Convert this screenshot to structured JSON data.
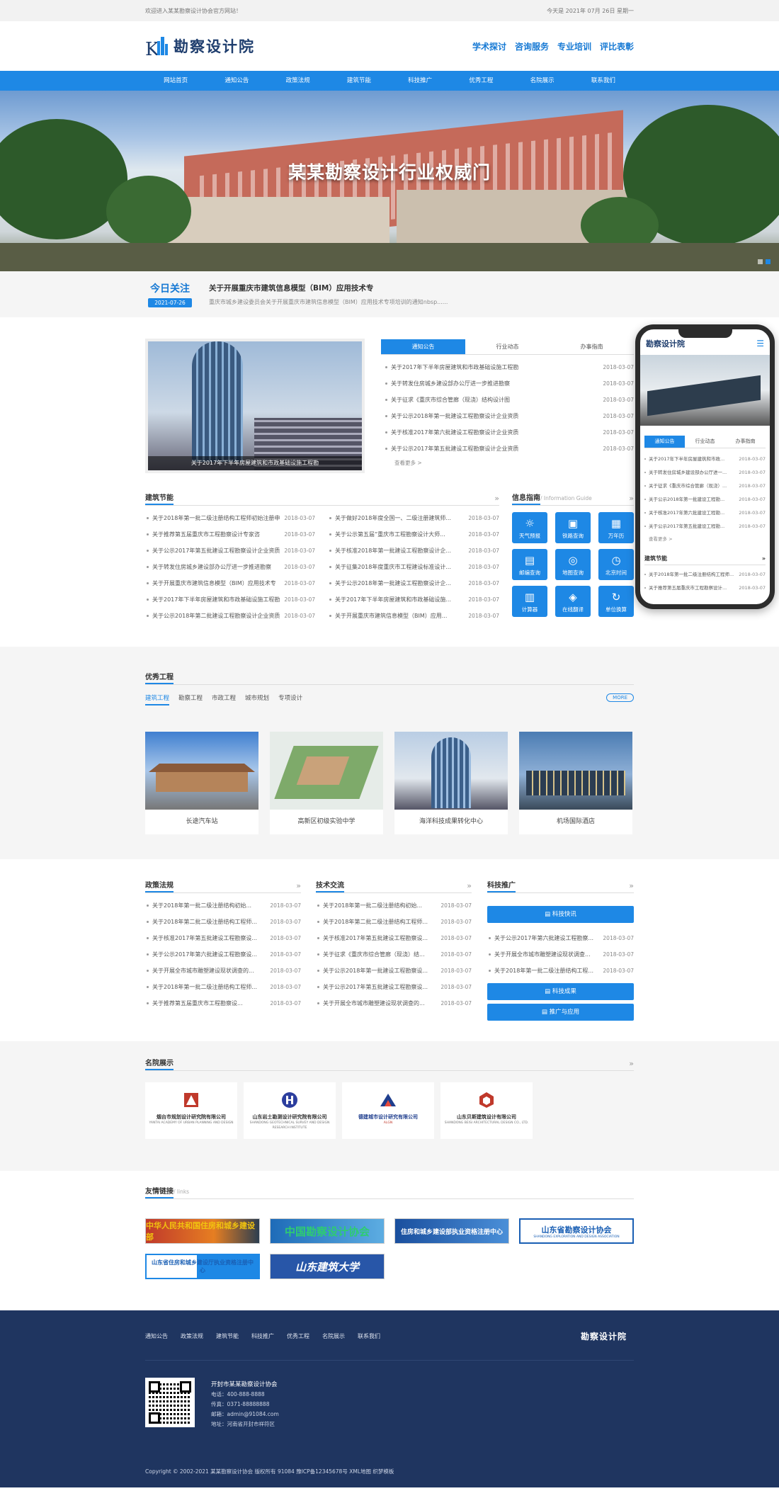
{
  "topbar": {
    "welcome": "欢迎进入某某勘察设计协会官方网站！",
    "date": "今天是 2021年 07月 26日 星期一"
  },
  "header": {
    "logo_text": "勘察设计院",
    "links": [
      "学术探讨",
      "咨询服务",
      "专业培训",
      "评比表彰"
    ]
  },
  "nav": [
    "网站首页",
    "通知公告",
    "政策法规",
    "建筑节能",
    "科技推广",
    "优秀工程",
    "名院展示",
    "联系我们"
  ],
  "banner": {
    "slogan": "某某勘察设计行业权威门"
  },
  "today": {
    "tag": "今日关注",
    "date": "2021-07-26",
    "title": "关于开展重庆市建筑信息模型（BIM）应用技术专",
    "desc": "重庆市城乡建设委员会关于开展重庆市建筑信息模型（BIM）应用技术专项培训的通知nbsp......"
  },
  "news": {
    "image_caption": "关于2017年下半年房屋建筑和市政基础设施工程勘",
    "tabs": [
      "通知公告",
      "行业动态",
      "办事指南"
    ],
    "items": [
      {
        "title": "关于2017年下半年房屋建筑和市政基础设施工程勘",
        "date": "2018-03-07"
      },
      {
        "title": "关于转发住房城乡建设部办公厅进一步推进勘察",
        "date": "2018-03-07"
      },
      {
        "title": "关于征求《重庆市综合管廊（现浇）结构设计图",
        "date": "2018-03-07"
      },
      {
        "title": "关于公示2018年第一批建设工程勘察设计企业资质",
        "date": "2018-03-07"
      },
      {
        "title": "关于核准2017年第六批建设工程勘察设计企业资质",
        "date": "2018-03-07"
      },
      {
        "title": "关于公示2017年第五批建设工程勘察设计企业资质",
        "date": "2018-03-07"
      }
    ],
    "more": "查看更多 >"
  },
  "energy": {
    "title": "建筑节能",
    "left": [
      {
        "title": "关于2018年第一批二级注册结构工程师初始注册申",
        "date": "2018-03-07"
      },
      {
        "title": "关于推荐第五届重庆市工程勘察设计专家咨",
        "date": "2018-03-07"
      },
      {
        "title": "关于公示2017年第五批建设工程勘察设计企业资质",
        "date": "2018-03-07"
      },
      {
        "title": "关于转发住房城乡建设部办公厅进一步推进勘察",
        "date": "2018-03-07"
      },
      {
        "title": "关于开展重庆市建筑信息模型（BIM）应用技术专",
        "date": "2018-03-07"
      },
      {
        "title": "关于2017年下半年房屋建筑和市政基础设施工程勘",
        "date": "2018-03-07"
      },
      {
        "title": "关于公示2018年第二批建设工程勘察设计企业资质",
        "date": "2018-03-07"
      }
    ],
    "right": [
      {
        "title": "关于做好2018年度全国一、二级注册建筑师...",
        "date": "2018-03-07"
      },
      {
        "title": "关于公示第五届“重庆市工程勘察设计大师...",
        "date": "2018-03-07"
      },
      {
        "title": "关于核准2018年第一批建设工程勘察设计企...",
        "date": "2018-03-07"
      },
      {
        "title": "关于征集2018年度重庆市工程建设标准设计...",
        "date": "2018-03-07"
      },
      {
        "title": "关于公示2018年第一批建设工程勘察设计企...",
        "date": "2018-03-07"
      },
      {
        "title": "关于2017年下半年房屋建筑和市政基础设施...",
        "date": "2018-03-07"
      },
      {
        "title": "关于开展重庆市建筑信息模型（BIM）应用...",
        "date": "2018-03-07"
      }
    ]
  },
  "guide": {
    "title": "信息指南",
    "subtitle": "/ Information Guide",
    "tools": [
      {
        "label": "天气预报",
        "icon": "☼"
      },
      {
        "label": "铁路查询",
        "icon": "▣"
      },
      {
        "label": "万年历",
        "icon": "▦"
      },
      {
        "label": "邮编查询",
        "icon": "▤"
      },
      {
        "label": "地图查询",
        "icon": "◎"
      },
      {
        "label": "北京时间",
        "icon": "◷"
      },
      {
        "label": "计算器",
        "icon": "▥"
      },
      {
        "label": "在线翻译",
        "icon": "◈"
      },
      {
        "label": "单位换算",
        "icon": "↻"
      }
    ]
  },
  "phone": {
    "logo": "勘察设计院",
    "tabs": [
      "通知公告",
      "行业动态",
      "办事指南"
    ],
    "items": [
      {
        "title": "关于2017年下半年房屋建筑和市政...",
        "date": "2018-03-07"
      },
      {
        "title": "关于转发住房城乡建设部办公厅进一...",
        "date": "2018-03-07"
      },
      {
        "title": "关于征求《重庆市综合管廊（现浇）...",
        "date": "2018-03-07"
      },
      {
        "title": "关于公示2018年第一批建设工程勘...",
        "date": "2018-03-07"
      },
      {
        "title": "关于核准2017年第六批建设工程勘...",
        "date": "2018-03-07"
      },
      {
        "title": "关于公示2017年第五批建设工程勘...",
        "date": "2018-03-07"
      }
    ],
    "more": "查看更多 >",
    "section": "建筑节能",
    "items2": [
      {
        "title": "关于2018年第一批二级注册结构工程师...",
        "date": "2018-03-07"
      },
      {
        "title": "关于推荐第五届重庆市工程勘察设计...",
        "date": "2018-03-07"
      }
    ]
  },
  "projects": {
    "title": "优秀工程",
    "tabs": [
      "建筑工程",
      "勘察工程",
      "市政工程",
      "城市规划",
      "专项设计"
    ],
    "more": "MORE",
    "items": [
      "长途汽车站",
      "高新区初级实验中学",
      "海洋科技成果转化中心",
      "机场国际酒店"
    ]
  },
  "policy": {
    "title": "政策法规",
    "items": [
      {
        "title": "关于2018年第一批二级注册结构初始...",
        "date": "2018-03-07"
      },
      {
        "title": "关于2018年第二批二级注册结构工程师...",
        "date": "2018-03-07"
      },
      {
        "title": "关于核准2017年第五批建设工程勘察设...",
        "date": "2018-03-07"
      },
      {
        "title": "关于公示2017年第六批建设工程勘察设...",
        "date": "2018-03-07"
      },
      {
        "title": "关于开展全市城市雕塑建设现状调查的...",
        "date": "2018-03-07"
      },
      {
        "title": "关于2018年第一批二级注册结构工程师...",
        "date": "2018-03-07"
      },
      {
        "title": "关于推荐第五届重庆市工程勘察设...",
        "date": "2018-03-07"
      }
    ]
  },
  "tech": {
    "title": "技术交流",
    "items": [
      {
        "title": "关于2018年第一批二级注册结构初始...",
        "date": "2018-03-07"
      },
      {
        "title": "关于2018年第二批二级注册结构工程师...",
        "date": "2018-03-07"
      },
      {
        "title": "关于核准2017年第五批建设工程勘察设...",
        "date": "2018-03-07"
      },
      {
        "title": "关于征求《重庆市综合管廊（现浇）结...",
        "date": "2018-03-07"
      },
      {
        "title": "关于公示2018年第一批建设工程勘察设...",
        "date": "2018-03-07"
      },
      {
        "title": "关于公示2017年第五批建设工程勘察设...",
        "date": "2018-03-07"
      },
      {
        "title": "关于开展全市城市雕塑建设现状调查的...",
        "date": "2018-03-07"
      }
    ]
  },
  "promo": {
    "title": "科技推广",
    "btn1": "科技快讯",
    "items": [
      {
        "title": "关于公示2017年第六批建设工程勘察...",
        "date": "2018-03-07"
      },
      {
        "title": "关于开展全市城市雕塑建设现状调查...",
        "date": "2018-03-07"
      },
      {
        "title": "关于2018年第一批二级注册结构工程...",
        "date": "2018-03-07"
      }
    ],
    "btn2": "科技成果",
    "btn3": "推广与应用"
  },
  "institutes": {
    "title": "名院展示",
    "items": [
      {
        "cn": "烟台市规划设计研究院有限公司",
        "en": "YANTAI ACADEMY OF URBAN PLANNING AND DESIGN"
      },
      {
        "cn": "山东岩土勘测设计研究院有限公司",
        "en": "SHANDONG GEOTECHNICAL SURVEY AND DESIGN RESEARCH INSTITUTE"
      },
      {
        "cn": "德建城市设计研究有限公司",
        "en": "ALGN"
      },
      {
        "cn": "山东贝斯建筑设计有限公司",
        "en": "SHANDONG BEISI ARCHITECTURAL DESIGN CO., LTD."
      }
    ]
  },
  "links": {
    "title": "友情链接",
    "subtitle": "/ links",
    "items": [
      "中华人民共和国住房和城乡建设部",
      "中国勘察设计协会",
      "住房和城乡建设部执业资格注册中心",
      "山东省勘察设计协会",
      "山东省住房和城乡建设厅执业资格注册中心",
      "山东建筑大学"
    ],
    "items_sub": [
      "",
      "",
      "",
      "SHANDONG EXPLORATION AND DESIGN ASSOCIATION",
      "",
      ""
    ]
  },
  "footer": {
    "nav": [
      "通知公告",
      "政策法规",
      "建筑节能",
      "科技推广",
      "优秀工程",
      "名院展示",
      "联系我们"
    ],
    "logo": "勘察设计院",
    "org": "开封市某某勘察设计协会",
    "phone": "电话：400-888-8888",
    "fax": "传真：0371-88888888",
    "email": "邮箱：admin@91084.com",
    "address": "地址：河南省开封市祥符区",
    "copyright": "Copyright © 2002-2021 某某勘察设计协会 版权所有 91084 豫ICP备12345678号 XML地图 织梦模板"
  },
  "colors": {
    "brand": "#1e88e5",
    "footer": "#1f3560",
    "logo": "#1f3e6e"
  }
}
